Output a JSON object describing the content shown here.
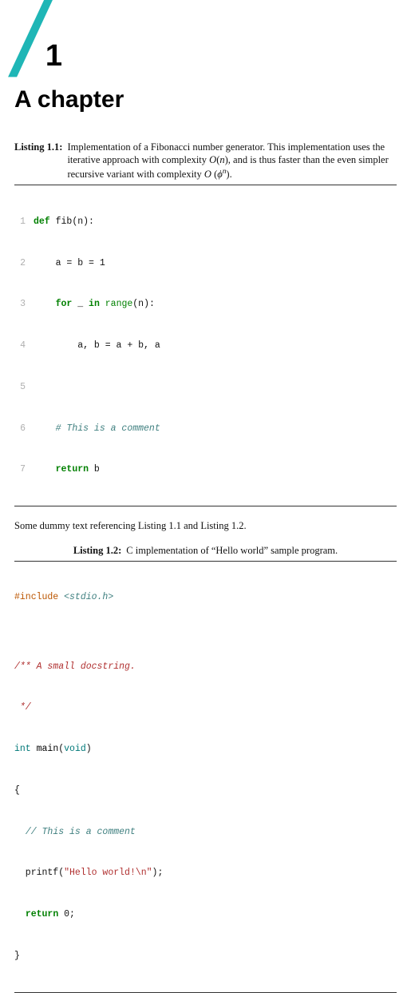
{
  "chapter": {
    "number": "1",
    "title": "A chapter"
  },
  "listing1": {
    "label": "Listing 1.1:",
    "caption_pre": "Implementation of a Fibonacci number generator. This implementation uses the iterative approach with complexity ",
    "complexity1_a": "O",
    "complexity1_b": "(",
    "complexity1_c": "n",
    "complexity1_d": ")",
    "caption_mid": ", and is thus faster than the even simpler recursive variant with complexity ",
    "complexity2_a": "O",
    "complexity2_b": " (",
    "complexity2_c": "ϕ",
    "complexity2_d": "n",
    "complexity2_e": ").",
    "ln": {
      "1": "1",
      "2": "2",
      "3": "3",
      "4": "4",
      "5": "5",
      "6": "6",
      "7": "7"
    },
    "code": {
      "l1a": "def",
      "l1b": " fib(n):",
      "l2": "    a = b = 1",
      "l3a": "    ",
      "l3b": "for",
      "l3c": " _ ",
      "l3d": "in",
      "l3e": " ",
      "l3f": "range",
      "l3g": "(n):",
      "l4": "        a, b = a + b, a",
      "l5": "",
      "l6a": "    ",
      "l6b": "# This is a comment",
      "l7a": "    ",
      "l7b": "return",
      "l7c": " b"
    }
  },
  "para": {
    "pre": "Some dummy text referencing ",
    "ref1": "Listing 1.1",
    "mid": " and ",
    "ref2": "Listing 1.2",
    "post": "."
  },
  "listing2": {
    "label": "Listing 1.2:",
    "caption": " C implementation of “Hello world” sample program.",
    "code": {
      "l1a": "#include",
      "l1b": " ",
      "l1c": "<stdio.h>",
      "blank": "",
      "doc1": "/** A small docstring.",
      "doc2": " */",
      "l4a": "int",
      "l4b": " ",
      "l4c": "main",
      "l4d": "(",
      "l4e": "void",
      "l4f": ")",
      "l5": "{",
      "l6a": "  ",
      "l6b": "// This is a comment",
      "l7a": "  printf(",
      "l7b": "\"Hello world!\\n\"",
      "l7c": ");",
      "l8a": "  ",
      "l8b": "return",
      "l8c": " ",
      "l8d": "0",
      "l8e": ";",
      "l9": "}"
    }
  }
}
